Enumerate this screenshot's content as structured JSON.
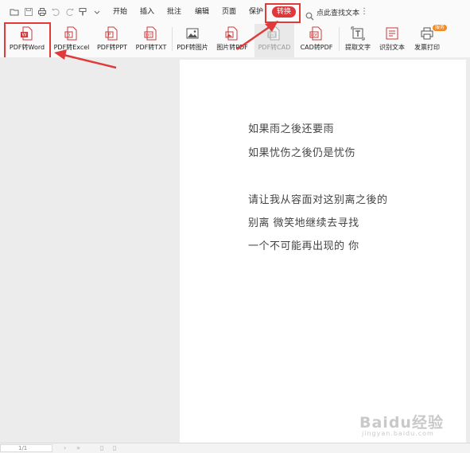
{
  "menubar": {
    "items": [
      "开始",
      "插入",
      "批注",
      "编辑",
      "页面",
      "保护",
      "转换"
    ],
    "active": "转换",
    "search_placeholder": "点此查找文本"
  },
  "ribbon": {
    "tools": [
      {
        "label": "PDF转Word",
        "icon": "pdf-to-word-icon"
      },
      {
        "label": "PDF转Excel",
        "icon": "pdf-to-excel-icon"
      },
      {
        "label": "PDF转PPT",
        "icon": "pdf-to-ppt-icon"
      },
      {
        "label": "PDF转TXT",
        "icon": "pdf-to-txt-icon"
      },
      {
        "label": "PDF转图片",
        "icon": "pdf-to-image-icon"
      },
      {
        "label": "图片转PDF",
        "icon": "image-to-pdf-icon"
      },
      {
        "label": "PDF转CAD",
        "icon": "pdf-to-cad-icon"
      },
      {
        "label": "CAD转PDF",
        "icon": "cad-to-pdf-icon"
      },
      {
        "label": "提取文字",
        "icon": "extract-text-icon"
      },
      {
        "label": "识别文本",
        "icon": "recognize-text-icon"
      },
      {
        "label": "发票打印",
        "icon": "invoice-print-icon"
      }
    ],
    "badge": "服务"
  },
  "document": {
    "lines": [
      "如果雨之後还要雨",
      "如果忧伤之後仍是忧伤",
      "请让我从容面对这别离之後的",
      "别离  微笑地继续去寻找",
      "一个不可能再出现的  你"
    ]
  },
  "statusbar": {
    "page": "1/1"
  },
  "watermark": {
    "main": "Baidu经验",
    "sub": "jingyan.baidu.com"
  },
  "colors": {
    "accent": "#e0373b",
    "annotation": "#e03a3a",
    "workspace": "#ececec"
  }
}
